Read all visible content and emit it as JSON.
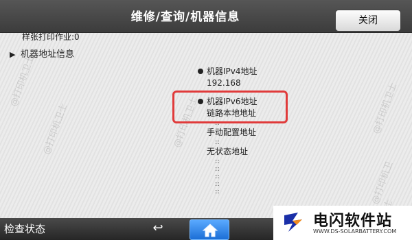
{
  "header": {
    "title": "维修/查询/机器信息",
    "close_label": "关闭"
  },
  "content": {
    "cut_off_row": "样张打印作业:0",
    "tree_item_label": "机器地址信息",
    "ipv4": {
      "label": "机器IPv4地址",
      "value": "192.168"
    },
    "ipv6": {
      "label": "机器IPv6地址",
      "link_local_label": "链路本地地址",
      "manual_label": "手动配置地址",
      "stateless_label": "无状态地址",
      "placeholder": "::"
    },
    "highlight_color": "#e03a3a"
  },
  "watermark_text": "@打印机卫士",
  "bottom": {
    "status_label": "检查状态",
    "back_icon": "↩",
    "home_icon": "home-icon",
    "home_color": "#2b83f0"
  },
  "logo": {
    "name": "电闪软件站",
    "url": "WWW.DS-SOLARBATTERY.COM"
  }
}
